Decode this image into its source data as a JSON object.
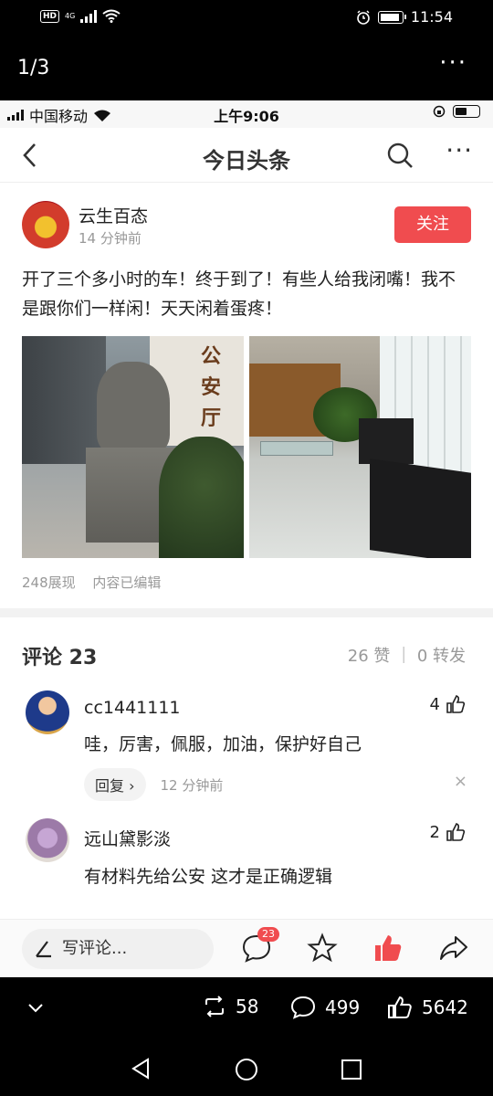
{
  "system_bar": {
    "hd": "HD",
    "network": "4G",
    "time": "11:54"
  },
  "viewer": {
    "page_counter": "1/3",
    "more": "···",
    "retweet_count": "58",
    "comment_count": "499",
    "like_count": "5642"
  },
  "ios_status": {
    "carrier": "中国移动",
    "time": "上午9:06"
  },
  "nav": {
    "title": "今日头条",
    "more": "···"
  },
  "post": {
    "author": "云生百态",
    "time": "14 分钟前",
    "follow_label": "关注",
    "text": "开了三个多小时的车！终于到了！有些人给我闭嘴！我不是跟你们一样闲！天天闲着蛋疼！",
    "photo_sign": "公安厅",
    "views": "248展现",
    "edited": "内容已编辑"
  },
  "comments": {
    "title": "评论 23",
    "meta": "26 赞 ｜ 0 转发",
    "items": [
      {
        "name": "cc1441111",
        "likes": "4",
        "text": "哇，厉害，佩服，加油，保护好自己",
        "reply_label": "回复",
        "time": "12 分钟前",
        "close": "×"
      },
      {
        "name": "远山黛影淡",
        "likes": "2",
        "text": "有材料先给公安 这才是正确逻辑"
      }
    ]
  },
  "bottom_bar": {
    "write_placeholder": "写评论...",
    "comment_badge": "23"
  },
  "colors": {
    "accent_red": "#f04c4f",
    "muted_text": "#999999"
  }
}
